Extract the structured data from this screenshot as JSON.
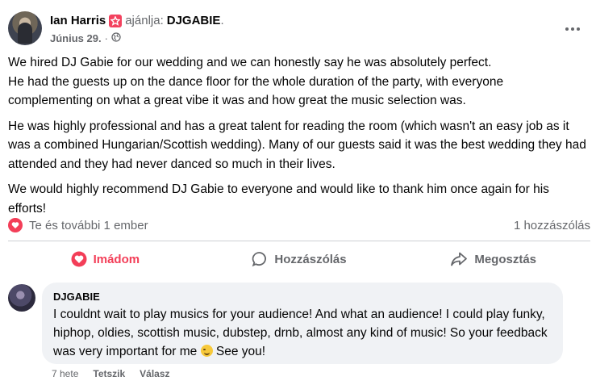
{
  "post": {
    "author": "Ian Harris",
    "recommends_text": "ajánlja:",
    "page_name": "DJGABIE",
    "period": ".",
    "date": "Június 29.",
    "dot": "·",
    "more_icon": "more-horizontal-icon",
    "paragraphs": [
      "We hired DJ Gabie for our wedding and we can honestly say he was absolutely perfect.\nHe had the guests up on the dance floor for the whole duration of the party, with everyone complementing on what a great vibe it was and how great the music selection was.",
      "He was highly professional and has a great talent for reading the room (which wasn't an easy job as it was a combined Hungarian/Scottish wedding). Many of our guests said it was the best wedding they had attended and they had never danced so much in their lives.",
      "We would highly recommend DJ Gabie to everyone and would like to thank him once again for his efforts!"
    ]
  },
  "reactions": {
    "summary": "Te és további 1 ember",
    "comments_count": "1 hozzászólás"
  },
  "actions": {
    "love": "Imádom",
    "comment": "Hozzászólás",
    "share": "Megosztás"
  },
  "comment": {
    "author": "DJGABIE",
    "text_before_emoji": "I couldnt wait to play musics for your audience! And what an audience! I could play funky, hiphop, oldies, scottish music, dubstep, drnb, almost any kind of music! So your feedback was very important for me ",
    "text_after_emoji": " See you!",
    "time": "7 hete",
    "like": "Tetszik",
    "reply": "Válasz"
  },
  "colors": {
    "love": "#f33e58",
    "secondary_text": "#65676b",
    "bubble": "#f0f2f5"
  }
}
